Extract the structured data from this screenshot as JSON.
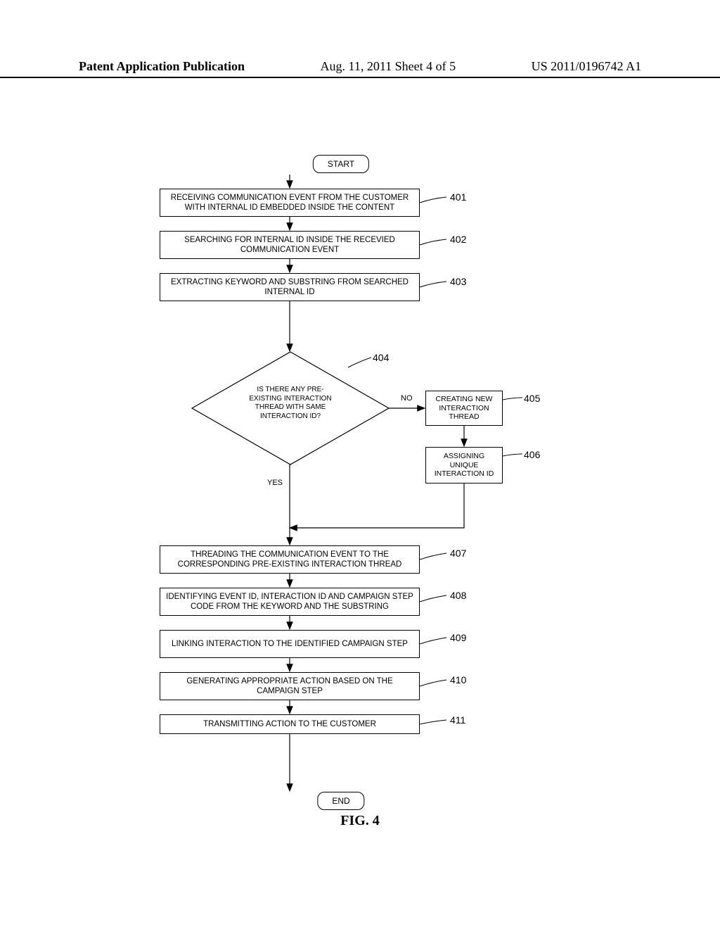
{
  "header": {
    "left": "Patent Application Publication",
    "mid": "Aug. 11, 2011   Sheet 4 of 5",
    "right": "US 2011/0196742 A1"
  },
  "flow": {
    "start": "START",
    "end": "END",
    "steps": {
      "s401": "RECEIVING COMMUNICATION EVENT FROM THE CUSTOMER WITH INTERNAL ID EMBEDDED INSIDE THE CONTENT",
      "s402": "SEARCHING FOR INTERNAL ID INSIDE THE RECEVIED COMMUNICATION EVENT",
      "s403": "EXTRACTING KEYWORD AND SUBSTRING FROM SEARCHED INTERNAL ID",
      "s404": "IS THERE ANY PRE-EXISTING INTERACTION THREAD WITH SAME INTERACTION ID?",
      "s405": "CREATING NEW INTERACTION THREAD",
      "s406": "ASSIGNING UNIQUE INTERACTION ID",
      "s407": "THREADING THE COMMUNICATION EVENT TO THE CORRESPONDING PRE-EXISTING INTERACTION THREAD",
      "s408": "IDENTIFYING EVENT ID, INTERACTION ID AND CAMPAIGN STEP CODE FROM THE KEYWORD AND THE SUBSTRING",
      "s409": "LINKING INTERACTION TO THE IDENTIFIED CAMPAIGN STEP",
      "s410": "GENERATING APPROPRIATE ACTION BASED ON THE CAMPAIGN STEP",
      "s411": "TRANSMITTING ACTION TO THE CUSTOMER"
    },
    "refs": {
      "r401": "401",
      "r402": "402",
      "r403": "403",
      "r404": "404",
      "r405": "405",
      "r406": "406",
      "r407": "407",
      "r408": "408",
      "r409": "409",
      "r410": "410",
      "r411": "411"
    },
    "labels": {
      "no": "NO",
      "yes": "YES"
    }
  },
  "figure_caption": "FIG. 4",
  "chart_data": {
    "type": "flowchart",
    "nodes": [
      {
        "id": "start",
        "type": "terminator",
        "text": "START"
      },
      {
        "id": "401",
        "type": "process",
        "text": "RECEIVING COMMUNICATION EVENT FROM THE CUSTOMER WITH INTERNAL ID EMBEDDED INSIDE THE CONTENT"
      },
      {
        "id": "402",
        "type": "process",
        "text": "SEARCHING FOR INTERNAL ID INSIDE THE RECEVIED COMMUNICATION EVENT"
      },
      {
        "id": "403",
        "type": "process",
        "text": "EXTRACTING KEYWORD AND SUBSTRING FROM SEARCHED INTERNAL ID"
      },
      {
        "id": "404",
        "type": "decision",
        "text": "IS THERE ANY PRE-EXISTING INTERACTION THREAD WITH SAME INTERACTION ID?"
      },
      {
        "id": "405",
        "type": "process",
        "text": "CREATING NEW INTERACTION THREAD"
      },
      {
        "id": "406",
        "type": "process",
        "text": "ASSIGNING UNIQUE INTERACTION ID"
      },
      {
        "id": "407",
        "type": "process",
        "text": "THREADING THE COMMUNICATION EVENT TO THE CORRESPONDING PRE-EXISTING INTERACTION THREAD"
      },
      {
        "id": "408",
        "type": "process",
        "text": "IDENTIFYING EVENT ID, INTERACTION ID AND CAMPAIGN STEP CODE FROM THE KEYWORD AND THE SUBSTRING"
      },
      {
        "id": "409",
        "type": "process",
        "text": "LINKING INTERACTION TO THE IDENTIFIED CAMPAIGN STEP"
      },
      {
        "id": "410",
        "type": "process",
        "text": "GENERATING APPROPRIATE ACTION BASED ON THE CAMPAIGN STEP"
      },
      {
        "id": "411",
        "type": "process",
        "text": "TRANSMITTING ACTION TO THE CUSTOMER"
      },
      {
        "id": "end",
        "type": "terminator",
        "text": "END"
      }
    ],
    "edges": [
      {
        "from": "start",
        "to": "401"
      },
      {
        "from": "401",
        "to": "402"
      },
      {
        "from": "402",
        "to": "403"
      },
      {
        "from": "403",
        "to": "404"
      },
      {
        "from": "404",
        "to": "405",
        "label": "NO"
      },
      {
        "from": "404",
        "to": "407",
        "label": "YES"
      },
      {
        "from": "405",
        "to": "406"
      },
      {
        "from": "406",
        "to": "407"
      },
      {
        "from": "407",
        "to": "408"
      },
      {
        "from": "408",
        "to": "409"
      },
      {
        "from": "409",
        "to": "410"
      },
      {
        "from": "410",
        "to": "411"
      },
      {
        "from": "411",
        "to": "end"
      }
    ]
  }
}
